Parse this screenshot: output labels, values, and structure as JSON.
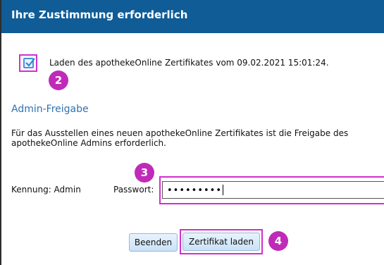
{
  "dialog": {
    "title": "Ihre Zustimmung erforderlich"
  },
  "certificate": {
    "checkbox_label": "Laden des apothekeOnline Zertifikates vom 09.02.2021 15:01:24.",
    "checked": true
  },
  "admin": {
    "section_title": "Admin-Freigabe",
    "description": "Für das Ausstellen eines neuen apothekeOnline Zertifikates ist die Freigabe des apothekeOnline Admins erforderlich.",
    "kennung_label": "Kennung: Admin",
    "password_label": "Passwort:",
    "password_value": "•••••••••"
  },
  "buttons": {
    "cancel_label": "Beenden",
    "load_label": "Zertifikat laden"
  },
  "annotations": {
    "step_checkbox": "2",
    "step_password": "3",
    "step_load": "4"
  },
  "colors": {
    "titlebar": "#0f5c96",
    "highlight": "#d22fcf",
    "badge": "#c02ab9",
    "section_title": "#2e73b4"
  }
}
